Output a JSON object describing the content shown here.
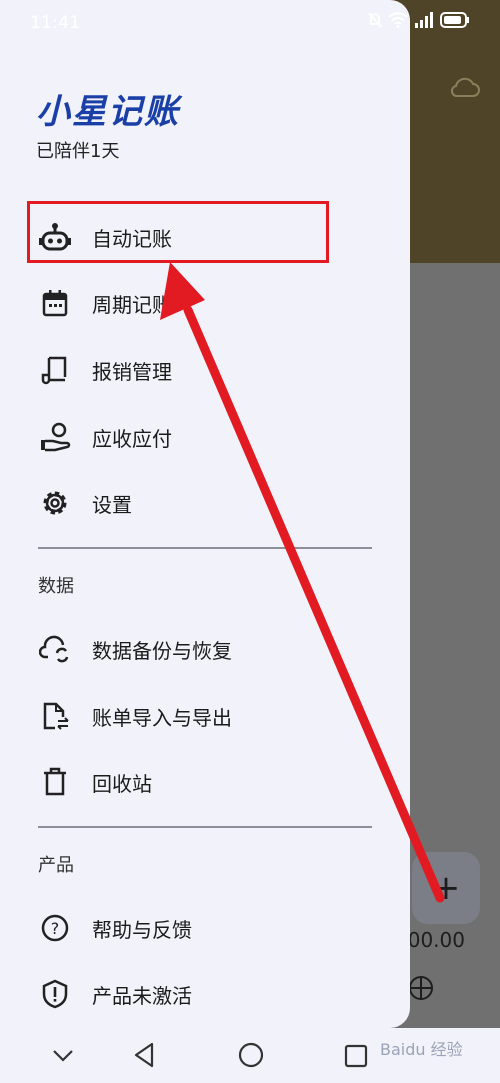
{
  "status": {
    "time": "11:41"
  },
  "app": {
    "title": "小星记账",
    "subtitle": "已陪伴1天"
  },
  "menu": {
    "auto_record": "自动记账",
    "periodic_record": "周期记账",
    "reimbursement": "报销管理",
    "receivable_payable": "应收应付",
    "settings": "设置"
  },
  "sections": {
    "data_title": "数据",
    "data_items": [
      "数据备份与恢复",
      "账单导入与导出",
      "回收站"
    ],
    "product_title": "产品",
    "product_items": [
      "帮助与反馈",
      "产品未激活"
    ]
  },
  "background": {
    "fab_label": "+",
    "amount": "000.00"
  },
  "watermark": "Baidu 经验",
  "colors": {
    "brand_title": "#1a3fa6",
    "highlight": "#e21b23",
    "drawer_bg": "#f2f2fb"
  }
}
